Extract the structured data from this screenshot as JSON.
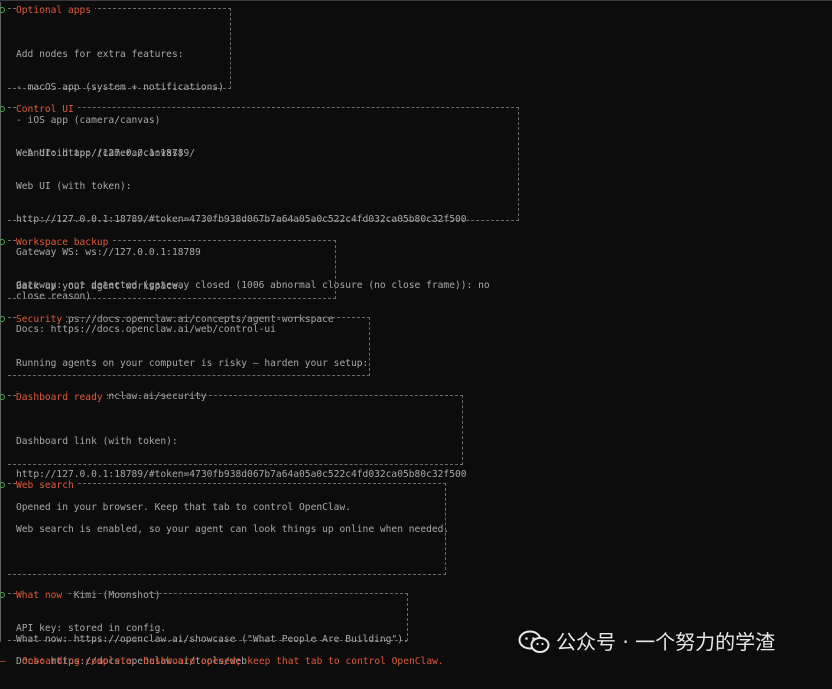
{
  "sections": {
    "optional_apps": {
      "title": "Optional apps",
      "lines": [
        "Add nodes for extra features:",
        "- macOS app (system + notifications)",
        "- iOS app (camera/canvas)",
        "- Android app (camera/canvas)"
      ]
    },
    "control_ui": {
      "title": "Control UI",
      "lines": [
        "Web UI: http://127.0.0.1:18789/",
        "Web UI (with token):",
        "http://127.0.0.1:18789/#token=4730fb938d067b7a64a05a0c522c4fd032ca05b80c32f500",
        "Gateway WS: ws://127.0.0.1:18789"
      ],
      "gateway_status": "Gateway: not detected (gateway closed (1006 abnormal closure (no close frame)): no close reason)",
      "docs": "Docs: https://docs.openclaw.ai/web/control-ui"
    },
    "workspace_backup": {
      "title": "Workspace backup",
      "lines": [
        "Back up your agent workspace.",
        "Docs: https://docs.openclaw.ai/concepts/agent-workspace"
      ]
    },
    "security": {
      "title": "Security",
      "lines": [
        "Running agents on your computer is risky — harden your setup:",
        "https://docs.openclaw.ai/security"
      ]
    },
    "dashboard_ready": {
      "title": "Dashboard ready",
      "lines": [
        "Dashboard link (with token):",
        "http://127.0.0.1:18789/#token=4730fb938d067b7a64a05a0c522c4fd032ca05b80c32f500",
        "Opened in your browser. Keep that tab to control OpenClaw."
      ]
    },
    "web_search": {
      "title": "Web search",
      "intro": "Web search is enabled, so your agent can look things up online when needed.",
      "lines": [
        "Provider: Kimi (Moonshot)",
        "API key: stored in config.",
        "Docs: https://docs.openclaw.ai/tools/web"
      ]
    },
    "what_now": {
      "title": "What now",
      "lines": [
        "What now: https://openclaw.ai/showcase (\"What People Are Building\")."
      ]
    }
  },
  "footer": {
    "dash": "—",
    "message": "Onboarding complete. Dashboard opened; keep that tab to control OpenClaw."
  },
  "watermark": {
    "text": "公众号 · 一个努力的学渣"
  },
  "colors": {
    "background": "#0c0c0c",
    "text": "#a8a8a8",
    "title": "#e05a3a",
    "bullet": "#3fae4a",
    "border": "#6a6a6a"
  }
}
